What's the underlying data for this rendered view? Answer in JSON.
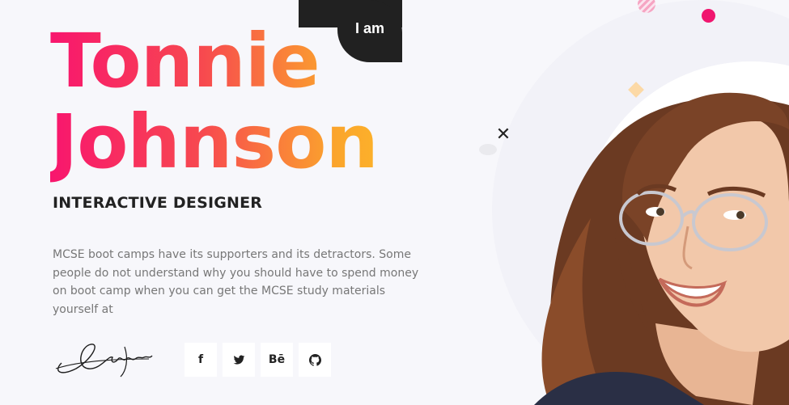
{
  "hero": {
    "intro_badge": "I am",
    "first_name": "Tonnie",
    "last_name": "Johnson",
    "role": "INTERACTIVE DESIGNER",
    "description": "MCSE boot camps have its supporters and its detractors. Some people do not understand why you should have to spend money on boot camp when you can get the MCSE study materials yourself at",
    "gradient_colors": [
      "#f8166e",
      "#fba52c",
      "#fdc028"
    ]
  },
  "social": {
    "buttons": [
      {
        "label": "f",
        "icon": "facebook-icon"
      },
      {
        "label": "twitter",
        "icon": "twitter-icon"
      },
      {
        "label": "Bē",
        "icon": "behance-icon"
      },
      {
        "label": "github",
        "icon": "github-icon"
      }
    ]
  }
}
